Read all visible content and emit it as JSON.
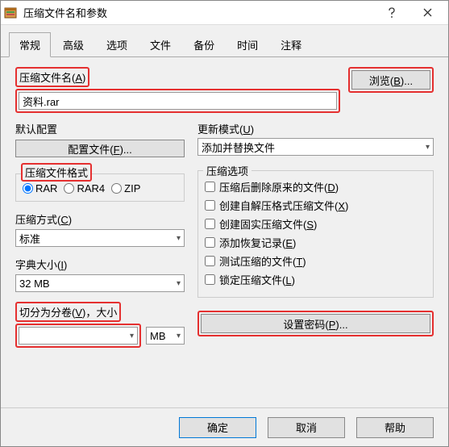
{
  "titlebar": {
    "title": "压缩文件名和参数"
  },
  "tabs": [
    "常规",
    "高级",
    "选项",
    "文件",
    "备份",
    "时间",
    "注释"
  ],
  "active_tab": 0,
  "filename": {
    "label_pre": "压缩文件名(",
    "label_u": "A",
    "label_post": ")",
    "value": "资料.rar",
    "browse_pre": "浏览(",
    "browse_u": "B",
    "browse_post": ")..."
  },
  "default_config": {
    "label": "默认配置",
    "button_pre": "配置文件(",
    "button_u": "F",
    "button_post": ")..."
  },
  "format": {
    "legend": "压缩文件格式",
    "options": [
      "RAR",
      "RAR4",
      "ZIP"
    ],
    "selected": 0
  },
  "method": {
    "label_pre": "压缩方式(",
    "label_u": "C",
    "label_post": ")",
    "value": "标准"
  },
  "dict": {
    "label_pre": "字典大小(",
    "label_u": "I",
    "label_post": ")",
    "value": "32 MB"
  },
  "split": {
    "label_pre": "切分为分卷(",
    "label_u": "V",
    "label_post": ")，大小",
    "value": "",
    "unit": "MB"
  },
  "update": {
    "label_pre": "更新模式(",
    "label_u": "U",
    "label_post": ")",
    "value": "添加并替换文件"
  },
  "options": {
    "legend": "压缩选项",
    "items": [
      {
        "pre": "压缩后删除原来的文件(",
        "u": "D",
        "post": ")"
      },
      {
        "pre": "创建自解压格式压缩文件(",
        "u": "X",
        "post": ")"
      },
      {
        "pre": "创建固实压缩文件(",
        "u": "S",
        "post": ")"
      },
      {
        "pre": "添加恢复记录(",
        "u": "E",
        "post": ")"
      },
      {
        "pre": "测试压缩的文件(",
        "u": "T",
        "post": ")"
      },
      {
        "pre": "锁定压缩文件(",
        "u": "L",
        "post": ")"
      }
    ]
  },
  "password": {
    "label_pre": "设置密码(",
    "label_u": "P",
    "label_post": ")..."
  },
  "footer": {
    "ok": "确定",
    "cancel": "取消",
    "help": "帮助"
  }
}
